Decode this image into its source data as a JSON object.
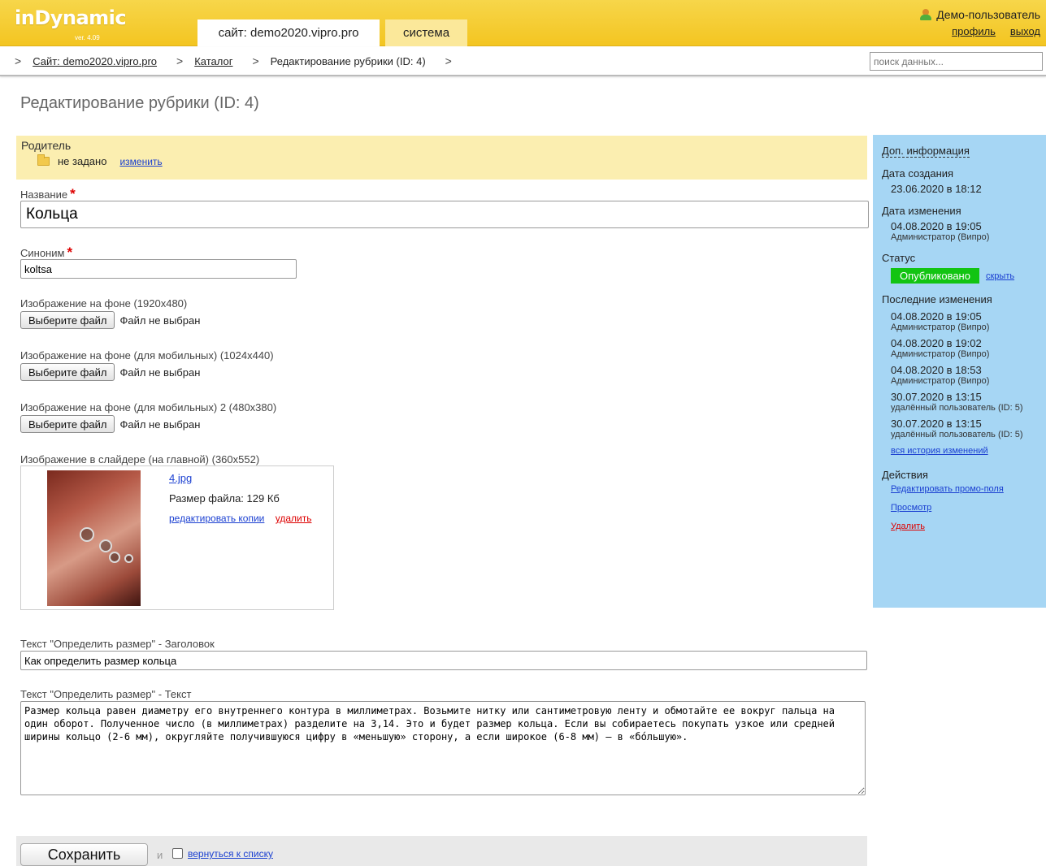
{
  "app": {
    "logo": "inDynamic",
    "version": "ver. 4.09"
  },
  "tabs": [
    {
      "label": "сайт: demo2020.vipro.pro",
      "active": true
    },
    {
      "label": "система",
      "active": false
    }
  ],
  "user": {
    "name": "Демо-пользователь",
    "profile_link": "профиль",
    "logout_link": "выход"
  },
  "breadcrumb": {
    "items": [
      "Сайт: demo2020.vipro.pro",
      "Каталог"
    ],
    "current": "Редактирование рубрики (ID: 4)"
  },
  "search": {
    "placeholder": "поиск данных..."
  },
  "page": {
    "title": "Редактирование рубрики (ID: 4)"
  },
  "form": {
    "parent": {
      "label": "Родитель",
      "value": "не задано",
      "change_link": "изменить"
    },
    "name": {
      "label": "Название",
      "required_mark": "*",
      "value": "Кольца"
    },
    "alias": {
      "label": "Синоним",
      "required_mark": "*",
      "value": "koltsa"
    },
    "file_button": "Выберите файл",
    "file_none": "Файл не выбран",
    "bg_image": {
      "label": "Изображение на фоне (1920x480)"
    },
    "bg_mobile": {
      "label": "Изображение на фоне (для мобильных) (1024x440)"
    },
    "bg_mobile2": {
      "label": "Изображение на фоне (для мобильных) 2 (480x380)"
    },
    "slider_image": {
      "label": "Изображение в слайдере (на главной) (360x552)",
      "file_name": "4.jpg",
      "file_size": "Размер файла: 129 Кб",
      "edit_copies_link": "редактировать копии",
      "delete_link": "удалить"
    },
    "size_title": {
      "label": "Текст \"Определить размер\" - Заголовок",
      "value": "Как определить размер кольца"
    },
    "size_text": {
      "label": "Текст \"Определить размер\" - Текст",
      "value": "Размер кольца равен диаметру его внутреннего контура в миллиметрах. Возьмите нитку или сантиметровую ленту и обмотайте ее вокруг пальца на один оборот. Полученное число (в миллиметрах) разделите на 3,14. Это и будет размер кольца. Если вы собираетесь покупать узкое или средней ширины кольцо (2-6 мм), округляйте получившуюся цифру в «меньшую» сторону, а если широкое (6-8 мм) — в «бóльшую»."
    },
    "save_button": "Сохранить",
    "and_text": "и",
    "back_to_list_link": "вернуться к списку"
  },
  "sidebar": {
    "heading": "Доп. информация",
    "created": {
      "label": "Дата создания",
      "value": "23.06.2020 в 18:12"
    },
    "modified": {
      "label": "Дата изменения",
      "value": "04.08.2020 в 19:05",
      "by": "Администратор (Випро)"
    },
    "status": {
      "label": "Статус",
      "value": "Опубликовано",
      "hide_link": "скрыть",
      "color": "#12c412"
    },
    "recent": {
      "label": "Последние изменения",
      "items": [
        {
          "date": "04.08.2020 в 19:05",
          "by": "Администратор (Випро)"
        },
        {
          "date": "04.08.2020 в 19:02",
          "by": "Администратор (Випро)"
        },
        {
          "date": "04.08.2020 в 18:53",
          "by": "Администратор (Випро)"
        },
        {
          "date": "30.07.2020 в 13:15",
          "by": "удалённый пользователь (ID: 5)"
        },
        {
          "date": "30.07.2020 в 13:15",
          "by": "удалённый пользователь (ID: 5)"
        }
      ],
      "all_history_link": "вся история изменений"
    },
    "actions": {
      "label": "Действия",
      "edit_promo": "Редактировать промо-поля",
      "view": "Просмотр",
      "delete": "Удалить"
    }
  },
  "colors": {
    "topbar": "#f3c521",
    "sidebar": "#a6d6f4",
    "parent_bg": "#fbeeb0",
    "link": "#1a3fd1",
    "danger": "#dd0000"
  }
}
